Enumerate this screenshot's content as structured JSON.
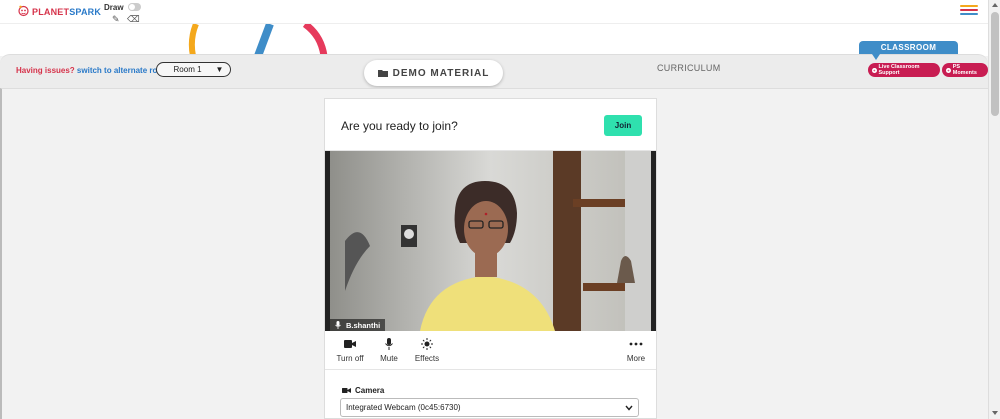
{
  "topbar": {
    "logo_text": "PLANETSPARK",
    "draw_label": "Draw",
    "draw_enabled": false,
    "icons": [
      "pencil-icon",
      "eraser-icon",
      "hamburger-menu-icon"
    ]
  },
  "nav": {
    "issues_text": "Having issues?",
    "alternate_link": "switch to alternate room",
    "room_value": "Room 1",
    "demo_tab": "DEMO MATERIAL",
    "curriculum_tab": "CURRICULUM",
    "classroom_tab": "CLASSROOM",
    "live_support": "Live Classroom Support",
    "ps_moments": "PS Moments"
  },
  "join_card": {
    "title": "Are you ready to join?",
    "join_label": "Join",
    "participant_name": "B.shanthi",
    "controls": {
      "turn_off": "Turn off",
      "mute": "Mute",
      "effects": "Effects",
      "more": "More"
    },
    "camera_label": "Camera",
    "camera_value": "Integrated Webcam (0c45:6730)"
  },
  "colors": {
    "join": "#2fe0ae",
    "classroom": "#3f8dc8",
    "pill": "#c81d52",
    "issues_red": "#d6324a",
    "issues_blue": "#2979c8"
  }
}
